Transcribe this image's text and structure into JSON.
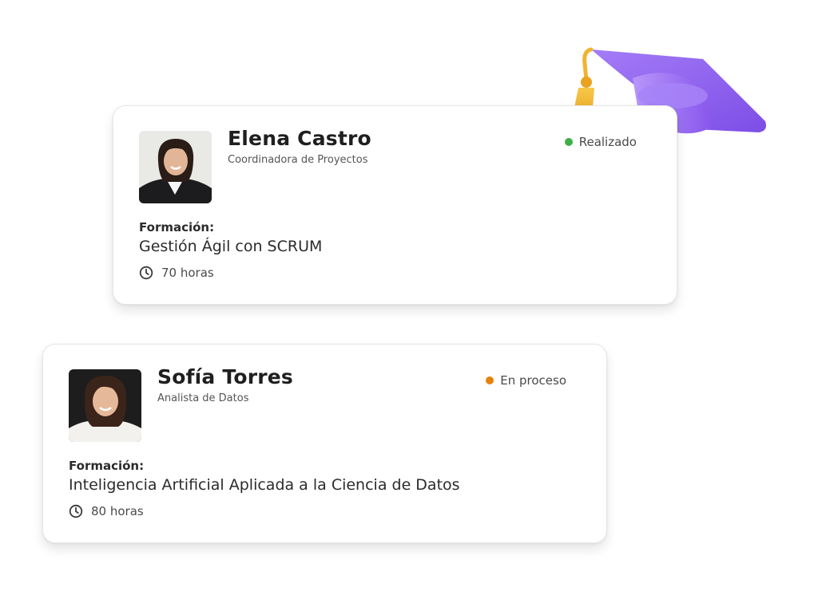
{
  "cards": [
    {
      "name": "Elena Castro",
      "role": "Coordinadora de Proyectos",
      "status": "Realizado",
      "status_color": "#3cb043",
      "formacion_label": "Formación:",
      "course": "Gestión Ágil con SCRUM",
      "hours": "70 horas"
    },
    {
      "name": "Sofía Torres",
      "role": "Analista de Datos",
      "status": "En proceso",
      "status_color": "#e8820c",
      "formacion_label": "Formación:",
      "course": "Inteligencia Artificial Aplicada a la Ciencia de Datos",
      "hours": "80 horas"
    }
  ],
  "icons": {
    "clock": "clock-icon",
    "decoration": "graduation-cap-icon"
  },
  "colors": {
    "cap_purple": "#8b5cf6",
    "tassel_gold": "#f2b632"
  }
}
